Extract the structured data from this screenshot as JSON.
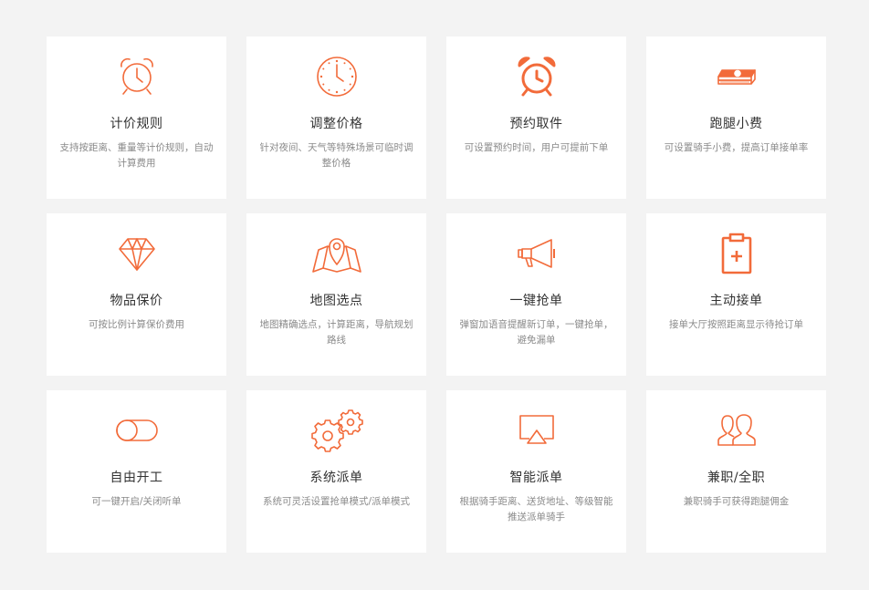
{
  "accent_color": "#f26b3a",
  "features": [
    {
      "icon": "alarm-clock-outline-icon",
      "title": "计价规则",
      "desc": "支持按距离、重量等计价规则，自动计算费用"
    },
    {
      "icon": "dotted-clock-icon",
      "title": "调整价格",
      "desc": "针对夜间、天气等特殊场景可临时调整价格"
    },
    {
      "icon": "alarm-clock-bold-icon",
      "title": "预约取件",
      "desc": "可设置预约时间，用户可提前下单"
    },
    {
      "icon": "money-stack-icon",
      "title": "跑腿小费",
      "desc": "可设置骑手小费，提高订单接单率"
    },
    {
      "icon": "diamond-icon",
      "title": "物品保价",
      "desc": "可按比例计算保价费用"
    },
    {
      "icon": "map-pin-icon",
      "title": "地图选点",
      "desc": "地图精确选点，计算距离，导航规划路线"
    },
    {
      "icon": "megaphone-icon",
      "title": "一键抢单",
      "desc": "弹窗加语音提醒新订单，一键抢单，避免漏单"
    },
    {
      "icon": "clipboard-plus-icon",
      "title": "主动接单",
      "desc": "接单大厅按照距离显示待抢订单"
    },
    {
      "icon": "toggle-switch-icon",
      "title": "自由开工",
      "desc": "可一键开启/关闭听单"
    },
    {
      "icon": "gears-icon",
      "title": "系统派单",
      "desc": "系统可灵活设置抢单模式/派单模式"
    },
    {
      "icon": "airplay-screen-icon",
      "title": "智能派单",
      "desc": "根据骑手距离、送货地址、等级智能推送派单骑手"
    },
    {
      "icon": "users-icon",
      "title": "兼职/全职",
      "desc": "兼职骑手可获得跑腿佣金"
    }
  ]
}
